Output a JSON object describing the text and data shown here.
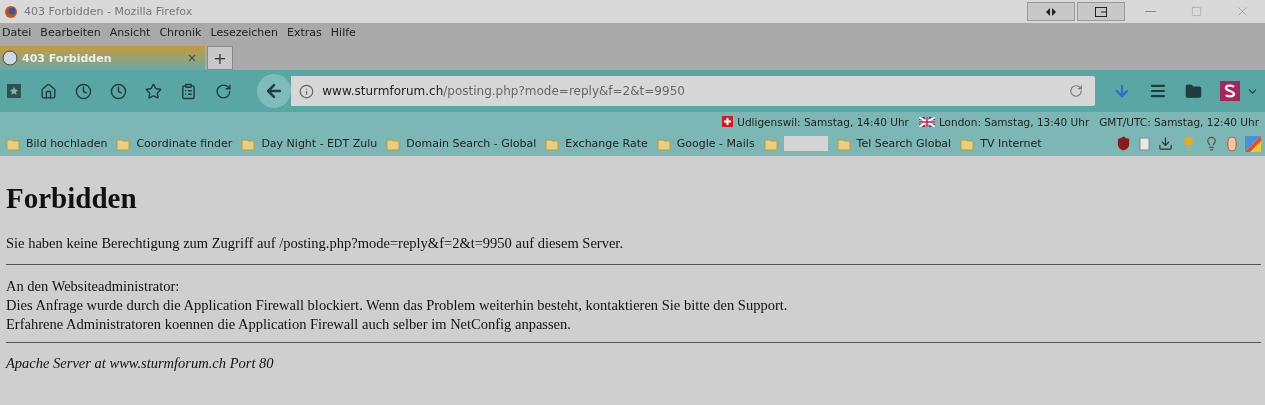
{
  "window": {
    "title": "403 Forbidden - Mozilla Firefox"
  },
  "menu": [
    "Datei",
    "Bearbeiten",
    "Ansicht",
    "Chronik",
    "Lesezeichen",
    "Extras",
    "Hilfe"
  ],
  "tabs": [
    {
      "label": "403 Forbidden",
      "selected": true,
      "close": "×"
    }
  ],
  "new_tab": "+",
  "address": {
    "host": "www.sturmforum.ch",
    "path": "/posting.php?mode=reply&f=2&t=9950"
  },
  "clocks": [
    {
      "kind": "swiss",
      "text": "Udligenswil: Samstag, 14:40 Uhr"
    },
    {
      "kind": "uk",
      "text": "London: Samstag, 13:40 Uhr"
    },
    {
      "kind": "none",
      "text": "GMT/UTC: Samstag, 12:40 Uhr"
    }
  ],
  "bookmarks": [
    {
      "kind": "folder",
      "label": "Bild hochladen"
    },
    {
      "kind": "folder",
      "label": "Coordinate finder"
    },
    {
      "kind": "folder",
      "label": "Day Night - EDT Zulu"
    },
    {
      "kind": "folder",
      "label": "Domain Search - Global"
    },
    {
      "kind": "folder",
      "label": "Exchange Rate"
    },
    {
      "kind": "folder",
      "label": "Google - Mails"
    },
    {
      "kind": "hidden"
    },
    {
      "kind": "folder",
      "label": "Tel Search Global"
    },
    {
      "kind": "folder",
      "label": "TV Internet"
    }
  ],
  "page": {
    "heading": "Forbidden",
    "message": "Sie haben keine Berechtigung zum Zugriff auf /posting.php?mode=reply&f=2&t=9950 auf diesem Server.",
    "admin_lines": [
      "An den Websiteadministrator:",
      "Dies Anfrage wurde durch die Application Firewall blockiert. Wenn das Problem weiterhin besteht, kontaktieren Sie bitte den Support.",
      "Erfahrene Administratoren koennen die Application Firewall auch selber im NetConfig anpassen."
    ],
    "footer": "Apache Server at www.sturmforum.ch Port 80"
  }
}
